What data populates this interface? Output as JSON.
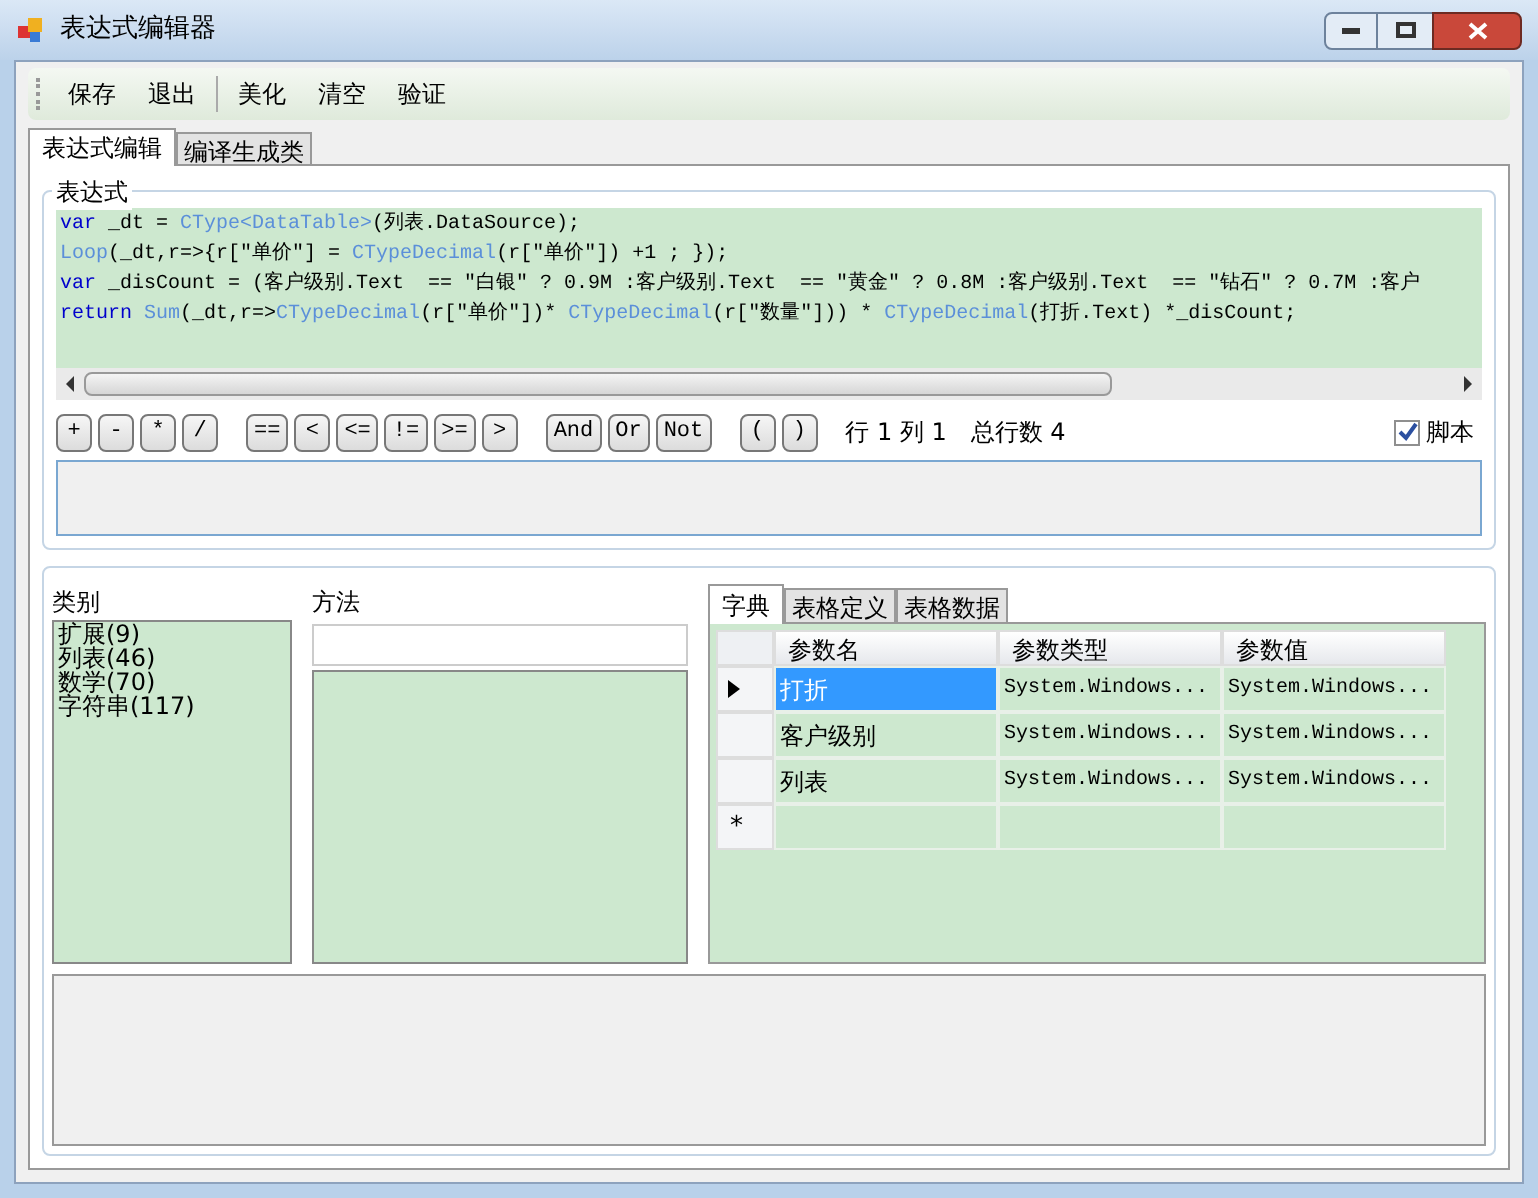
{
  "window": {
    "title": "表达式编辑器"
  },
  "toolbar": [
    [
      "保存",
      "退出"
    ],
    [
      "美化",
      "清空",
      "验证"
    ]
  ],
  "tabs": [
    {
      "label": "表达式编辑",
      "selected": true
    },
    {
      "label": "编译生成类",
      "selected": false
    }
  ],
  "expression": {
    "title": "表达式",
    "code": [
      [
        {
          "kind": "keyword",
          "text": "var"
        },
        {
          "kind": "plain",
          "text": " _dt = "
        },
        {
          "kind": "type",
          "text": "CType<DataTable>"
        },
        {
          "kind": "plain",
          "text": "(列表.DataSource);"
        }
      ],
      [
        {
          "kind": "type",
          "text": "Loop"
        },
        {
          "kind": "plain",
          "text": "(_dt,r=>{r[\"单价\"] = "
        },
        {
          "kind": "type",
          "text": "CTypeDecimal"
        },
        {
          "kind": "plain",
          "text": "(r[\"单价\"]) +1 ; });"
        }
      ],
      [
        {
          "kind": "keyword",
          "text": "var"
        },
        {
          "kind": "plain",
          "text": " _disCount = (客户级别.Text  == \"白银\" ? 0.9M :客户级别.Text  == \"黄金\" ? 0.8M :客户级别.Text  == \"钻石\" ? 0.7M :客户"
        }
      ],
      [
        {
          "kind": "keyword",
          "text": "return "
        },
        {
          "kind": "type",
          "text": "Sum"
        },
        {
          "kind": "plain",
          "text": "(_dt,r=>"
        },
        {
          "kind": "type",
          "text": "CTypeDecimal"
        },
        {
          "kind": "plain",
          "text": "(r[\"单价\"])* "
        },
        {
          "kind": "type",
          "text": "CTypeDecimal"
        },
        {
          "kind": "plain",
          "text": "(r[\"数量\"])) * "
        },
        {
          "kind": "type",
          "text": "CTypeDecimal"
        },
        {
          "kind": "plain",
          "text": "(打折.Text) *_disCount;"
        }
      ]
    ],
    "operator_groups": [
      [
        "+",
        "-",
        "*",
        "/"
      ],
      [
        "==",
        "<",
        "<=",
        "!=",
        ">=",
        ">"
      ],
      [
        "And",
        "Or",
        "Not"
      ],
      [
        "(",
        ")"
      ]
    ],
    "status": [
      "行 1 列 1",
      "总行数 4"
    ],
    "script": {
      "label": "脚本",
      "checked": true
    }
  },
  "categories": {
    "title": "类别",
    "items": [
      "扩展(9)",
      "列表(46)",
      "数学(70)",
      "字符串(117)"
    ]
  },
  "methods": {
    "title": "方法"
  },
  "param_tabs": [
    {
      "label": "字典",
      "selected": true
    },
    {
      "label": "表格定义",
      "selected": false
    },
    {
      "label": "表格数据",
      "selected": false
    }
  ],
  "grid": {
    "columns": [
      "参数名",
      "参数类型",
      "参数值"
    ],
    "rows": [
      {
        "cells": [
          "打折",
          "System.Windows...",
          "System.Windows..."
        ],
        "selected": true
      },
      {
        "cells": [
          "客户级别",
          "System.Windows...",
          "System.Windows..."
        ],
        "selected": false
      },
      {
        "cells": [
          "列表",
          "System.Windows...",
          "System.Windows..."
        ],
        "selected": false
      }
    ],
    "new_row_mark": "*"
  }
}
